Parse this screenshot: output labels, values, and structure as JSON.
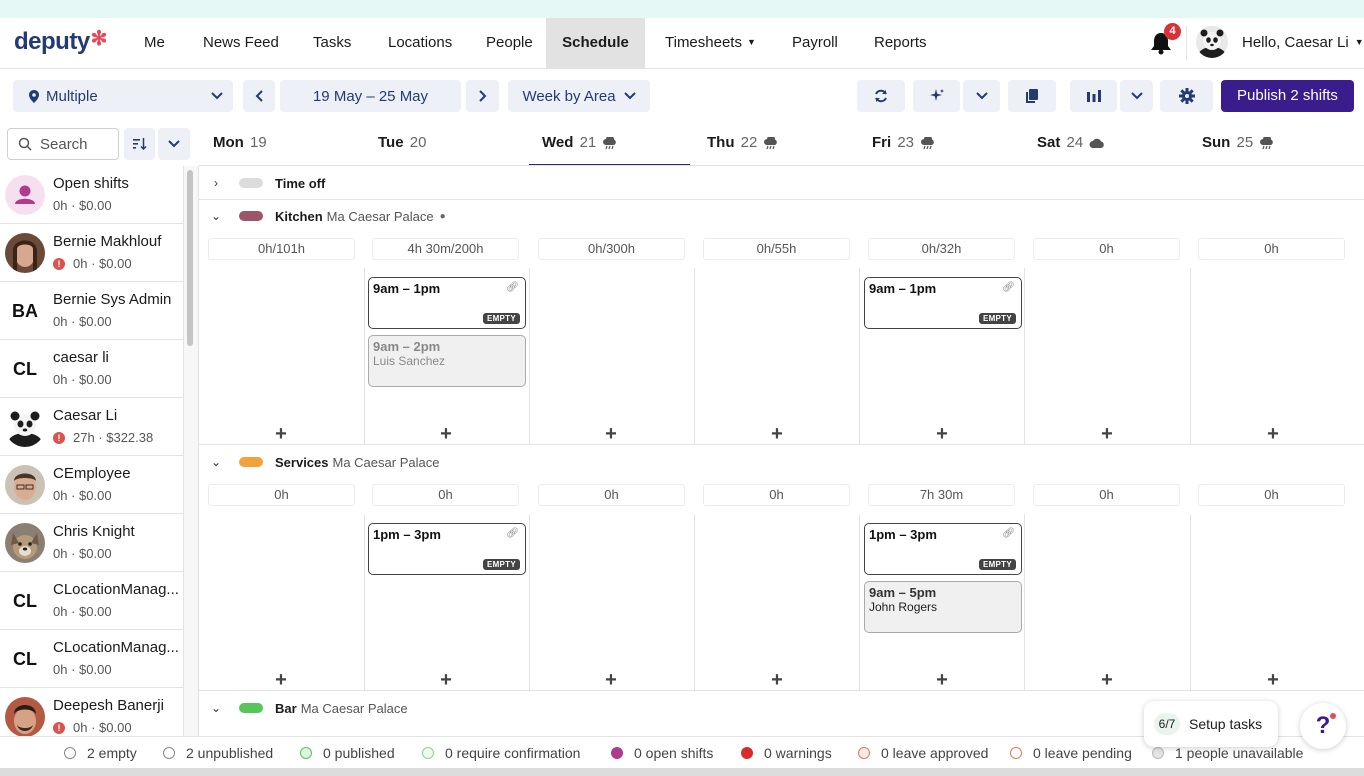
{
  "app": {
    "logo": "deputy"
  },
  "nav": {
    "items": [
      "Me",
      "News Feed",
      "Tasks",
      "Locations",
      "People",
      "Schedule",
      "Timesheets",
      "Payroll",
      "Reports"
    ],
    "active": "Schedule",
    "notifications": "4",
    "greeting": "Hello, Caesar Li"
  },
  "toolbar": {
    "location": "Multiple",
    "date_range": "19 May – 25 May",
    "view": "Week by Area",
    "publish": "Publish 2 shifts"
  },
  "search": {
    "placeholder": "Search"
  },
  "days": [
    {
      "name": "Mon",
      "num": "19",
      "weather": ""
    },
    {
      "name": "Tue",
      "num": "20",
      "weather": ""
    },
    {
      "name": "Wed",
      "num": "21",
      "weather": "rain-icon"
    },
    {
      "name": "Thu",
      "num": "22",
      "weather": "rain-icon"
    },
    {
      "name": "Fri",
      "num": "23",
      "weather": "rain-icon"
    },
    {
      "name": "Sat",
      "num": "24",
      "weather": "cloud-icon"
    },
    {
      "name": "Sun",
      "num": "25",
      "weather": "rain-icon"
    }
  ],
  "people": [
    {
      "name": "Open shifts",
      "meta": "0h · $0.00",
      "warn": false,
      "avatar": "open"
    },
    {
      "name": "Bernie Makhlouf",
      "meta": "0h · $0.00",
      "warn": true,
      "avatar": "photo"
    },
    {
      "name": "Bernie Sys Admin",
      "meta": "0h · $0.00",
      "warn": false,
      "initials": "BA"
    },
    {
      "name": "caesar li",
      "meta": "0h · $0.00",
      "warn": false,
      "initials": "CL"
    },
    {
      "name": "Caesar Li",
      "meta": "27h · $322.38",
      "warn": true,
      "avatar": "panda"
    },
    {
      "name": "CEmployee",
      "meta": "0h · $0.00",
      "warn": false,
      "avatar": "photo"
    },
    {
      "name": "Chris Knight",
      "meta": "0h · $0.00",
      "warn": false,
      "avatar": "dog"
    },
    {
      "name": "CLocationManag...",
      "meta": "0h · $0.00",
      "warn": false,
      "initials": "CL"
    },
    {
      "name": "CLocationManag...",
      "meta": "0h · $0.00",
      "warn": false,
      "initials": "CL"
    },
    {
      "name": "Deepesh Banerji",
      "meta": "0h · $0.00",
      "warn": true,
      "avatar": "photo"
    }
  ],
  "areas": {
    "timeoff": {
      "name": "Time off"
    },
    "kitchen": {
      "name": "Kitchen",
      "location": "Ma Caesar Palace",
      "color": "#9c5566",
      "stats": [
        "0h/101h",
        "4h 30m/200h",
        "0h/300h",
        "0h/55h",
        "0h/32h",
        "0h",
        "0h"
      ]
    },
    "services": {
      "name": "Services",
      "location": "Ma Caesar Palace",
      "color": "#f2a23a",
      "stats": [
        "0h",
        "0h",
        "0h",
        "0h",
        "7h 30m",
        "0h",
        "0h"
      ]
    },
    "bar": {
      "name": "Bar",
      "location": "Ma Caesar Palace",
      "color": "#57c45c"
    }
  },
  "shifts": {
    "k_tue_open": {
      "time": "9am – 1pm",
      "tag": "EMPTY"
    },
    "k_tue_luis": {
      "time": "9am – 2pm",
      "person": "Luis Sanchez"
    },
    "k_fri_open": {
      "time": "9am – 1pm",
      "tag": "EMPTY"
    },
    "s_tue_open": {
      "time": "1pm – 3pm",
      "tag": "EMPTY"
    },
    "s_fri_open": {
      "time": "1pm – 3pm",
      "tag": "EMPTY"
    },
    "s_fri_john": {
      "time": "9am – 5pm",
      "person": "John Rogers"
    }
  },
  "legend": [
    {
      "label": "2 empty",
      "color": "#ffffff",
      "border": "#888"
    },
    {
      "label": "2 unpublished",
      "color": "#ffffff",
      "border": "#888"
    },
    {
      "label": "0 published",
      "color": "#dff5df",
      "border": "#57c45c"
    },
    {
      "label": "0 require confirmation",
      "color": "#eef8ee",
      "border": "#8fd48f"
    },
    {
      "label": "0 open shifts",
      "color": "#b03a8c",
      "border": "#b03a8c"
    },
    {
      "label": "0 warnings",
      "color": "#d92b2b",
      "border": "#d92b2b"
    },
    {
      "label": "0 leave approved",
      "color": "#fbe9e3",
      "border": "#e07a5f"
    },
    {
      "label": "0 leave pending",
      "color": "#ffffff",
      "border": "#e07a5f"
    },
    {
      "label": "1 people unavailable",
      "color": "#e4e4e4",
      "border": "#bbb"
    }
  ],
  "setup": {
    "count": "6/7",
    "label": "Setup tasks"
  },
  "help": {
    "label": "?"
  }
}
